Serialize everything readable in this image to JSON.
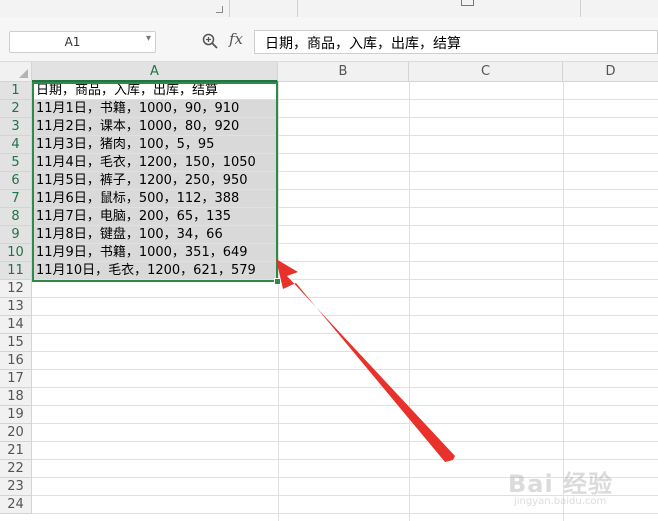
{
  "formula_bar": {
    "name_box": "A1",
    "fx_label": "fx",
    "content": "日期，商品，入库，出库，结算"
  },
  "columns": [
    "A",
    "B",
    "C",
    "D"
  ],
  "rows": [
    "1",
    "2",
    "3",
    "4",
    "5",
    "6",
    "7",
    "8",
    "9",
    "10",
    "11",
    "12",
    "13",
    "14",
    "15",
    "16",
    "17",
    "18",
    "19",
    "20",
    "21",
    "22",
    "23",
    "24"
  ],
  "cells_a": [
    "日期，商品，入库，出库，结算",
    "11月1日，书籍，1000，90，910",
    "11月2日，课本，1000，80，920",
    "11月3日，猪肉，100，5，95",
    "11月4日，毛衣，1200，150，1050",
    "11月5日，裤子，1200，250，950",
    "11月6日，鼠标，500，112，388",
    "11月7日，电脑，200，65，135",
    "11月8日，键盘，100，34，66",
    " 11月9日，书籍，1000，351，649",
    " 11月10日，毛衣，1200，621，579"
  ],
  "watermark": {
    "text": "Bai 经验",
    "sub": "jingyan.baidu.com"
  },
  "colors": {
    "selection": "#2e8b47",
    "arrow": "#e8312a",
    "selected_fill": "#d9d9d9"
  }
}
